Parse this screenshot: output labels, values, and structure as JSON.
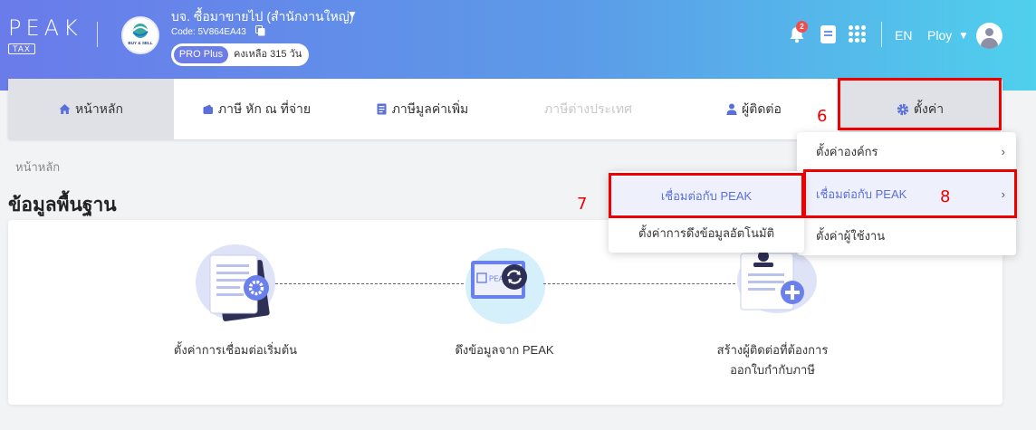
{
  "header": {
    "logo_text": "PEAK",
    "logo_sub": "TAX",
    "company_logo_text": "BUY & SELL",
    "company_name": "บจ. ซื้อมาขายไป (สำนักงานใหญ่)",
    "company_code": "Code: 5V864EA43",
    "plan": "PRO Plus",
    "remaining": "คงเหลือ 315 วัน",
    "notification_count": "2",
    "language": "EN",
    "user_name": "Ploy"
  },
  "nav": {
    "items": [
      {
        "label": "หน้าหลัก",
        "icon": "home-icon"
      },
      {
        "label": "ภาษี หัก ณ ที่จ่าย",
        "icon": "wallet-icon"
      },
      {
        "label": "ภาษีมูลค่าเพิ่ม",
        "icon": "receipt-icon"
      },
      {
        "label": "ภาษีต่างประเทศ"
      },
      {
        "label": "ผู้ติดต่อ",
        "icon": "person-icon"
      },
      {
        "label": "ตั้งค่า",
        "icon": "gear-icon"
      }
    ]
  },
  "breadcrumb": "หน้าหลัก",
  "page_title": "ข้อมูลพื้นฐาน",
  "steps": [
    {
      "label": "ตั้งค่าการเชื่อมต่อเริ่มต้น"
    },
    {
      "label": "ดึงข้อมูลจาก PEAK"
    },
    {
      "label_line1": "สร้างผู้ติดต่อที่ต้องการ",
      "label_line2": "ออกใบกำกับภาษี"
    }
  ],
  "settings_menu": {
    "items": [
      {
        "label": "ตั้งค่าองค์กร"
      },
      {
        "label": "เชื่อมต่อกับ PEAK"
      },
      {
        "label": "ตั้งค่าผู้ใช้งาน"
      }
    ]
  },
  "submenu": {
    "items": [
      {
        "label": "เชื่อมต่อกับ PEAK"
      },
      {
        "label": "ตั้งค่าการดึงข้อมูลอัตโนมัติ"
      }
    ]
  },
  "annotations": {
    "n6": "6",
    "n7": "7",
    "n8": "8"
  },
  "colors": {
    "accent": "#5b6fd8",
    "highlight_box": "#e00000",
    "header_start": "#6a7bea",
    "header_end": "#4fd0ec"
  }
}
